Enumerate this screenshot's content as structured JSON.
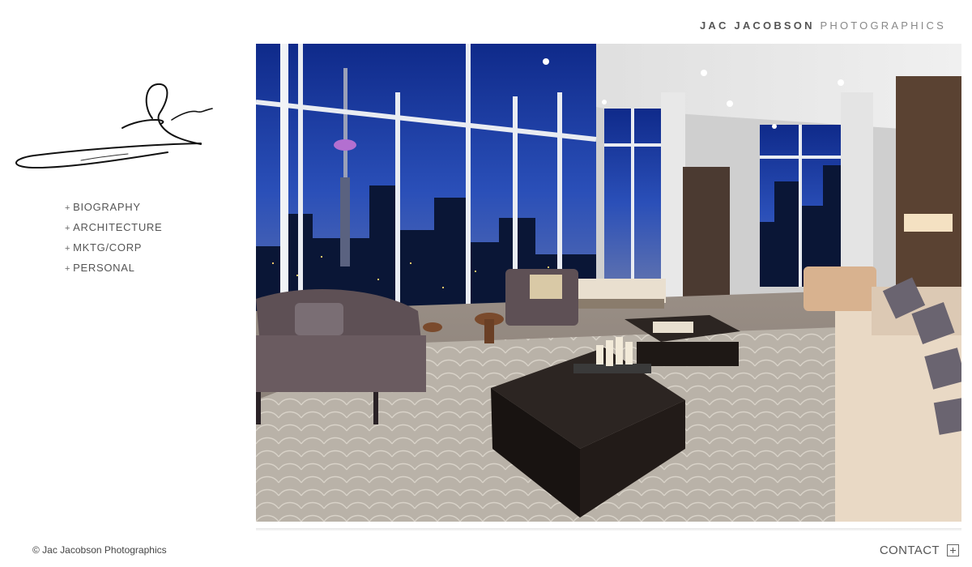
{
  "header": {
    "brand_bold": "JAC JACOBSON",
    "brand_light": "PHOTOGRAPHICS"
  },
  "nav": {
    "items": [
      {
        "prefix": "+",
        "label": "BIOGRAPHY"
      },
      {
        "prefix": "+",
        "label": "ARCHITECTURE"
      },
      {
        "prefix": "+",
        "label": "MKTG/CORP"
      },
      {
        "prefix": "+",
        "label": "PERSONAL"
      }
    ]
  },
  "hero": {
    "subject": "penthouse living room at dusk"
  },
  "footer": {
    "copyright": "© Jac Jacobson Photographics",
    "contact_label": "CONTACT",
    "contact_icon": "plus-box-icon"
  },
  "colors": {
    "text": "#444444",
    "accent_sky": "#1e3a7a"
  }
}
